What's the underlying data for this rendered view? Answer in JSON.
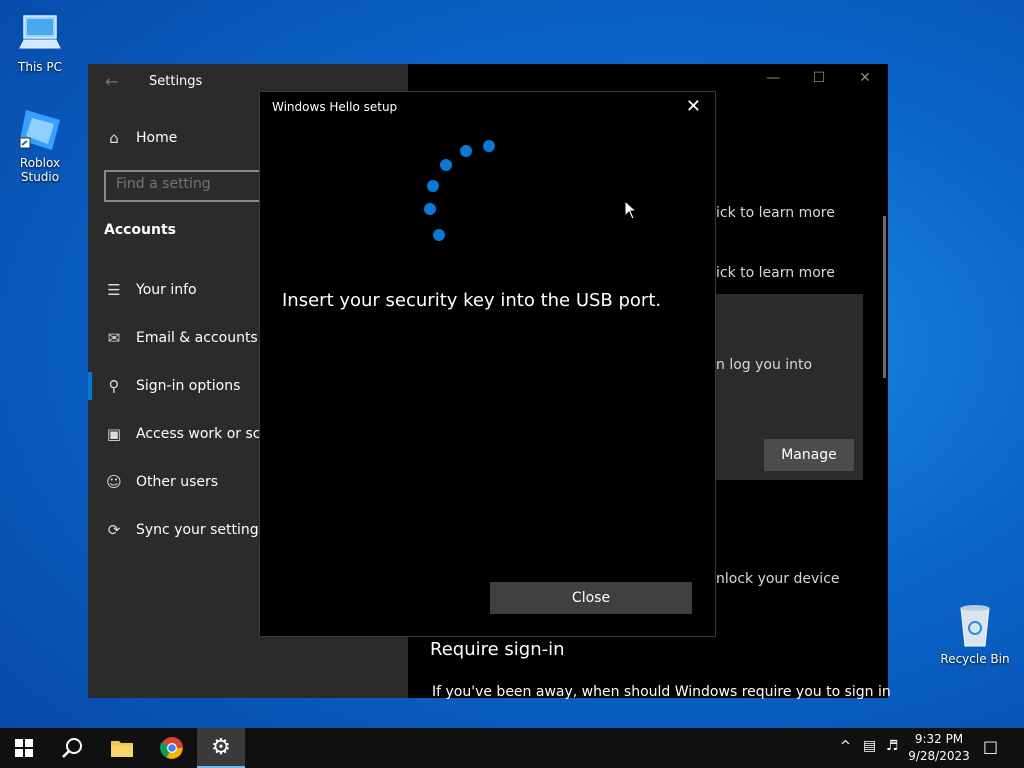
{
  "desktop": {
    "icons": [
      {
        "label": "This PC"
      },
      {
        "label": "Roblox Studio"
      },
      {
        "label": "Recycle Bin"
      }
    ]
  },
  "settings_window": {
    "title": "Settings",
    "home_label": "Home",
    "search_placeholder": "Find a setting",
    "section": "Accounts",
    "nav": [
      {
        "label": "Your info",
        "icon": "person-card-icon"
      },
      {
        "label": "Email & accounts",
        "icon": "mail-icon"
      },
      {
        "label": "Sign-in options",
        "icon": "key-icon"
      },
      {
        "label": "Access work or school",
        "icon": "briefcase-icon"
      },
      {
        "label": "Other users",
        "icon": "person-add-icon"
      },
      {
        "label": "Sync your settings",
        "icon": "sync-icon"
      }
    ],
    "right_pane": {
      "link1": "ick to learn more",
      "link2": "ick to learn more",
      "card_text": "n log you into",
      "manage_label": "Manage",
      "unlock_text": "nlock your device",
      "require_heading": "Require sign-in",
      "require_desc": "If you've been away, when should Windows require you to sign in"
    }
  },
  "dialog": {
    "title": "Windows Hello setup",
    "message": "Insert your security key into the USB port.",
    "close_label": "Close"
  },
  "taskbar": {
    "time": "9:32 PM",
    "date": "9/28/2023"
  },
  "colors": {
    "accent": "#0078d7",
    "spinner": "#0a78d6"
  }
}
